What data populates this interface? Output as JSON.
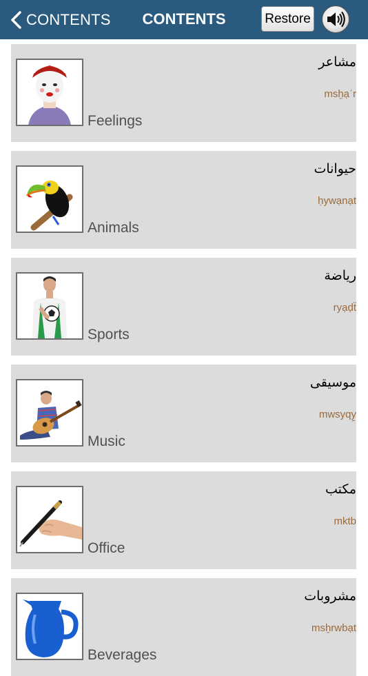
{
  "header": {
    "back_label": "CONTENTS",
    "title": "CONTENTS",
    "restore_label": "Restore",
    "sound_icon": "speaker-volume-icon",
    "bar_color": "#2a5a7e"
  },
  "categories": [
    {
      "english": "Feelings",
      "arabic": "مشاعر",
      "transliteration": "msẖạʿr",
      "image": "mime-face-image"
    },
    {
      "english": "Animals",
      "arabic": "حيوانات",
      "transliteration": "ḥywạnạt",
      "image": "toucan-image"
    },
    {
      "english": "Sports",
      "arabic": "رياضة",
      "transliteration": "ryạḍẗ",
      "image": "soccer-player-image"
    },
    {
      "english": "Music",
      "arabic": "موسيقى",
      "transliteration": "mwsyqy̱",
      "image": "guitar-player-image"
    },
    {
      "english": "Office",
      "arabic": "مكتب",
      "transliteration": "mktb",
      "image": "hand-with-pen-image"
    },
    {
      "english": "Beverages",
      "arabic": "مشروبات",
      "transliteration": "msẖrwbạt",
      "image": "blue-pitcher-image"
    }
  ]
}
